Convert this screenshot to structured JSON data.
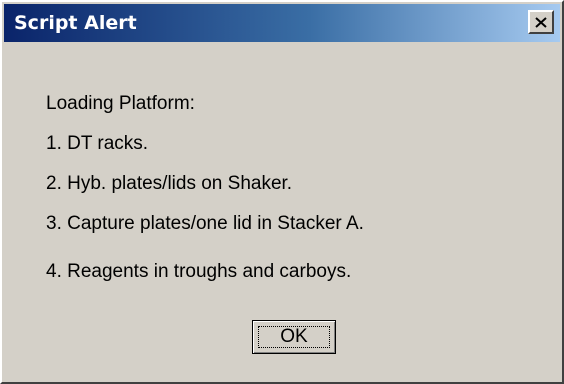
{
  "window": {
    "title": "Script Alert",
    "close_label": "close",
    "colors": {
      "titlebar_start": "#0a246a",
      "titlebar_end": "#a6caf0",
      "face": "#d4d0c8"
    }
  },
  "message": {
    "lines": [
      "Loading Platform:",
      "1. DT racks.",
      "2. Hyb. plates/lids on Shaker.",
      "3. Capture plates/one lid in Stacker A.",
      "4. Reagents in troughs and carboys."
    ]
  },
  "buttons": {
    "ok_label": "OK"
  },
  "icons": {
    "close": "close-icon"
  }
}
